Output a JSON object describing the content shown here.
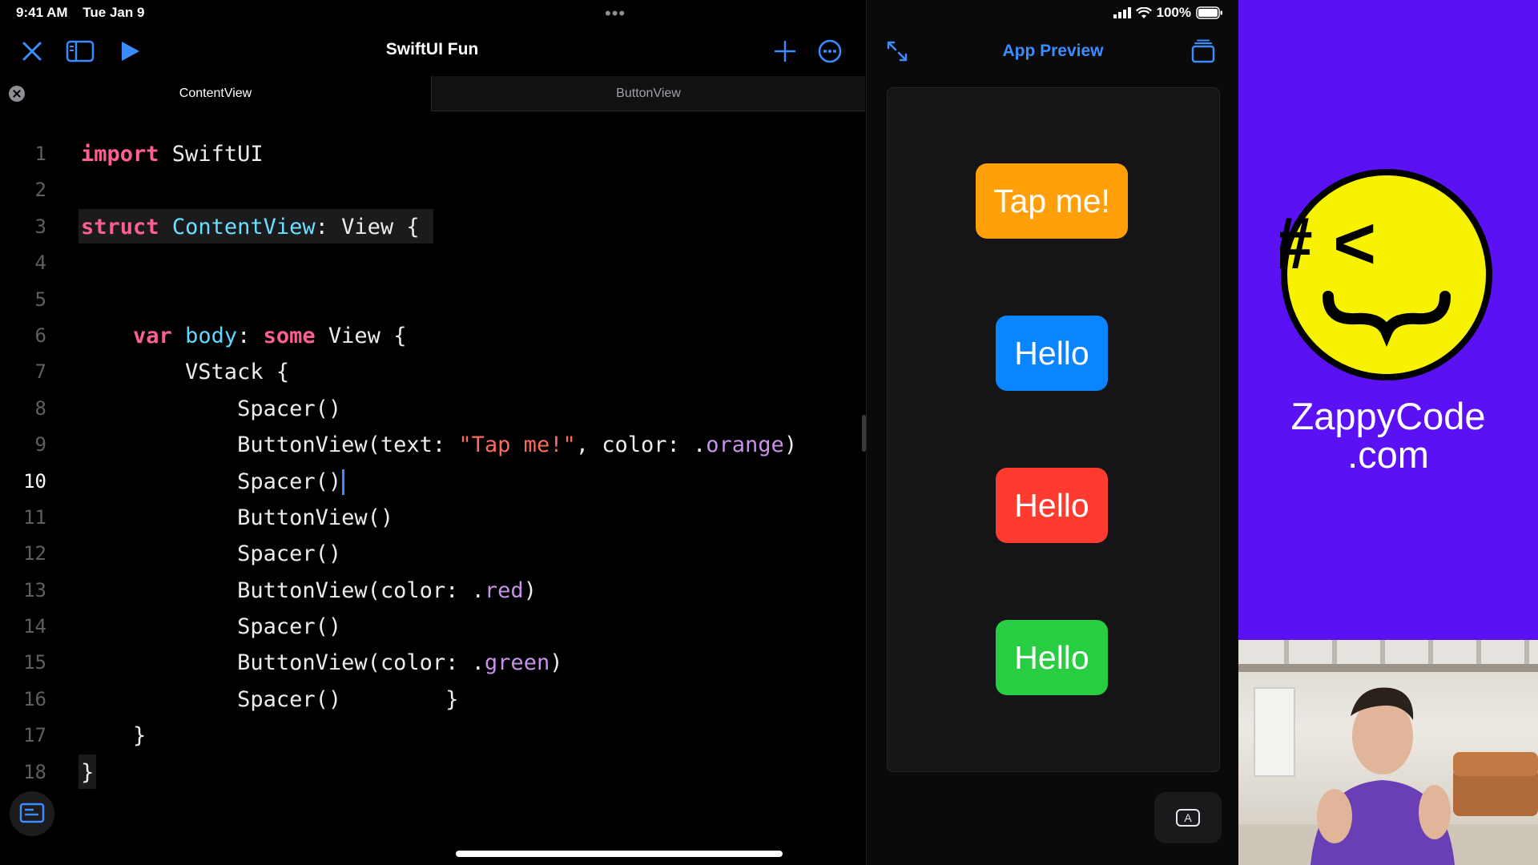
{
  "status_bar": {
    "time": "9:41 AM",
    "date": "Tue Jan 9",
    "battery": "100%"
  },
  "toolbar": {
    "title": "SwiftUI Fun"
  },
  "tabs": [
    {
      "label": "ContentView"
    },
    {
      "label": "ButtonView"
    }
  ],
  "code_lines": [
    {
      "n": "1",
      "text": "import SwiftUI"
    },
    {
      "n": "2",
      "text": ""
    },
    {
      "n": "3",
      "text": "struct ContentView: View {"
    },
    {
      "n": "4",
      "text": ""
    },
    {
      "n": "5",
      "text": ""
    },
    {
      "n": "6",
      "text": "    var body: some View {"
    },
    {
      "n": "7",
      "text": "        VStack {"
    },
    {
      "n": "8",
      "text": "            Spacer()"
    },
    {
      "n": "9",
      "text": "            ButtonView(text: \"Tap me!\", color: .orange)"
    },
    {
      "n": "10",
      "text": "            Spacer()"
    },
    {
      "n": "11",
      "text": "            ButtonView()"
    },
    {
      "n": "12",
      "text": "            Spacer()"
    },
    {
      "n": "13",
      "text": "            ButtonView(color: .red)"
    },
    {
      "n": "14",
      "text": "            Spacer()"
    },
    {
      "n": "15",
      "text": "            ButtonView(color: .green)"
    },
    {
      "n": "16",
      "text": "            Spacer()        }"
    },
    {
      "n": "17",
      "text": "    }"
    },
    {
      "n": "18",
      "text": "}"
    }
  ],
  "current_line": "10",
  "preview": {
    "title": "App Preview",
    "buttons": [
      {
        "label": "Tap me!",
        "color": "#FF9F0A"
      },
      {
        "label": "Hello",
        "color": "#0A84FF"
      },
      {
        "label": "Hello",
        "color": "#FF3B30"
      },
      {
        "label": "Hello",
        "color": "#28CD41"
      }
    ],
    "font_button_label": "A"
  },
  "brand": {
    "line1": "ZappyCode",
    "line2": ".com",
    "logo_text": "# <",
    "background": "#5A12F5"
  },
  "colors": {
    "accent": "#3B8CFF"
  }
}
